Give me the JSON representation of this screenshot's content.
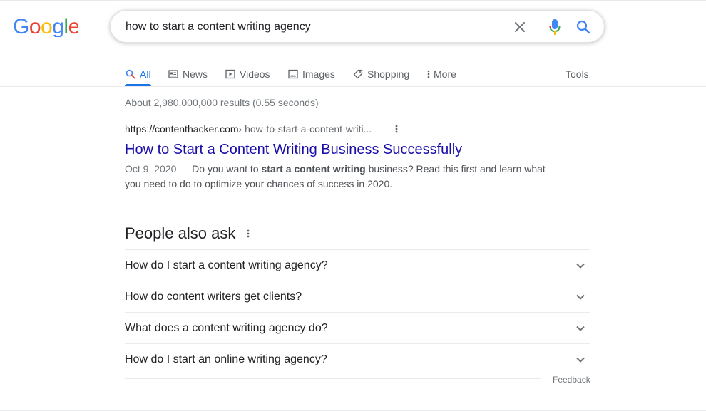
{
  "logo": {
    "text": "Google"
  },
  "search": {
    "query": "how to start a content writing agency"
  },
  "icons": {
    "clear": "close-icon",
    "mic": "microphone-icon",
    "search": "search-icon"
  },
  "tabs": {
    "all": "All",
    "news": "News",
    "videos": "Videos",
    "images": "Images",
    "shopping": "Shopping",
    "more": "More",
    "tools": "Tools"
  },
  "stats": "About 2,980,000,000 results (0.55 seconds)",
  "result": {
    "domain": "https://contenthacker.com",
    "path": " › how-to-start-a-content-writi...",
    "title": "How to Start a Content Writing Business Successfully",
    "date": "Oct 9, 2020",
    "snippet_pre": " — Do you want to ",
    "snippet_bold": "start a content writing",
    "snippet_post": " business? Read this first and learn what you need to do to optimize your chances of success in 2020."
  },
  "paa": {
    "title": "People also ask",
    "questions": [
      "How do I start a content writing agency?",
      "How do content writers get clients?",
      "What does a content writing agency do?",
      "How do I start an online writing agency?"
    ],
    "feedback": "Feedback"
  },
  "colors": {
    "accent": "#1a73e8",
    "link": "#1a0dab",
    "google_blue": "#4285f4",
    "google_red": "#ea4335",
    "google_yellow": "#fbbc05",
    "google_green": "#34a853"
  }
}
